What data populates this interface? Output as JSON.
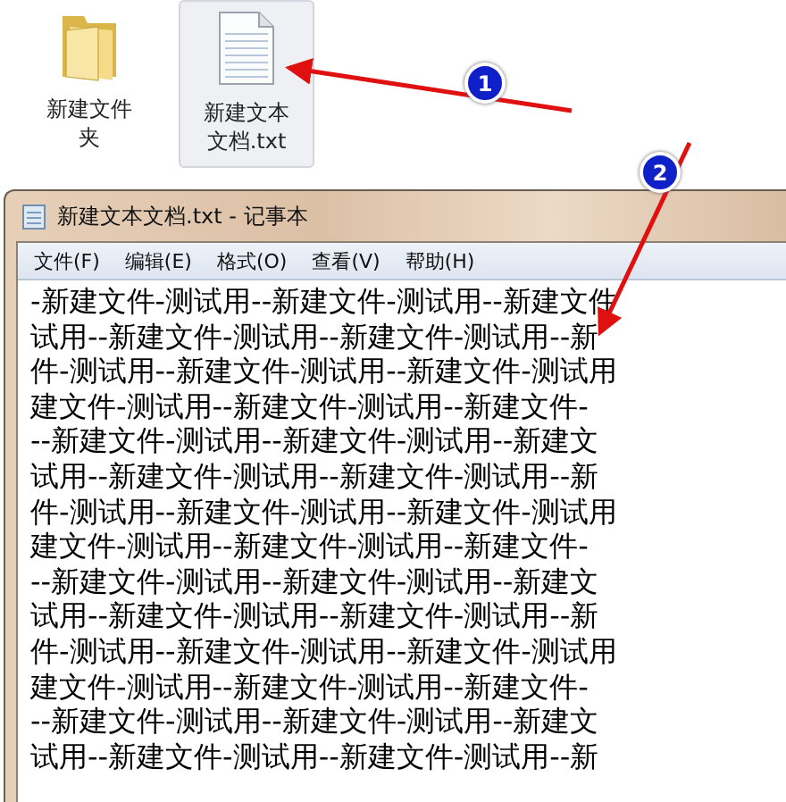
{
  "desktop_icons": [
    {
      "kind": "folder",
      "label": "新建文件夹",
      "selected": false
    },
    {
      "kind": "text_file",
      "label": "新建文本文档.txt",
      "selected": true
    }
  ],
  "callouts": [
    {
      "number": "1"
    },
    {
      "number": "2"
    }
  ],
  "window": {
    "title": "新建文本文档.txt - 记事本"
  },
  "menu": [
    "文件(F)",
    "编辑(E)",
    "格式(O)",
    "查看(V)",
    "帮助(H)"
  ],
  "text_lines": [
    "-新建文件-测试用--新建文件-测试用--新建文件",
    "试用--新建文件-测试用--新建文件-测试用--新",
    "件-测试用--新建文件-测试用--新建文件-测试用",
    "建文件-测试用--新建文件-测试用--新建文件-",
    "--新建文件-测试用--新建文件-测试用--新建文",
    "试用--新建文件-测试用--新建文件-测试用--新",
    "件-测试用--新建文件-测试用--新建文件-测试用",
    "建文件-测试用--新建文件-测试用--新建文件-",
    "--新建文件-测试用--新建文件-测试用--新建文",
    "试用--新建文件-测试用--新建文件-测试用--新",
    "件-测试用--新建文件-测试用--新建文件-测试用",
    "建文件-测试用--新建文件-测试用--新建文件-",
    "--新建文件-测试用--新建文件-测试用--新建文",
    "试用--新建文件-测试用--新建文件-测试用--新"
  ]
}
